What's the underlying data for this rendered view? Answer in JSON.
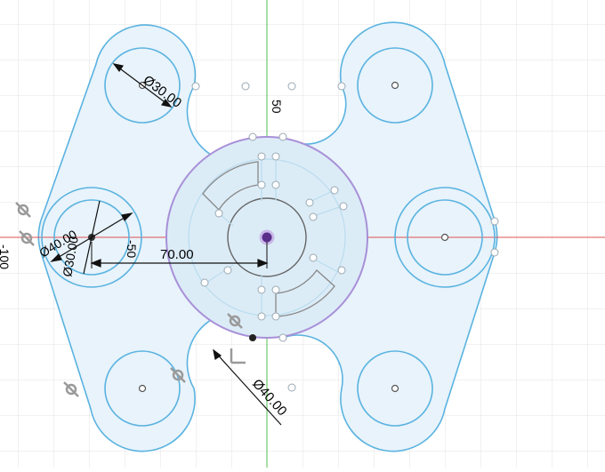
{
  "sketch": {
    "dimensions": {
      "top_left_diameter": "Ø30.00",
      "left_outer_diameter": "Ø40.00",
      "left_inner_diameter": "Ø30.00",
      "bottom_diameter": "Ø40.00",
      "horizontal_distance": "70.00"
    },
    "ruler": {
      "v_50": "50",
      "h_minus_50": "-50",
      "h_minus_100": "-100"
    },
    "colors": {
      "profile_fill": "#e8f3fb",
      "profile_stroke": "#5ab3e0",
      "construction": "#b9dcee",
      "selected_circle": "#a890d8",
      "axis_x": "#e05050",
      "axis_y": "#50c050",
      "grid": "#e3e3e3",
      "dimension": "#111111"
    },
    "icons": [
      "tangent-constraint-icon",
      "coincident-constraint-icon",
      "perpendicular-constraint-icon"
    ]
  }
}
